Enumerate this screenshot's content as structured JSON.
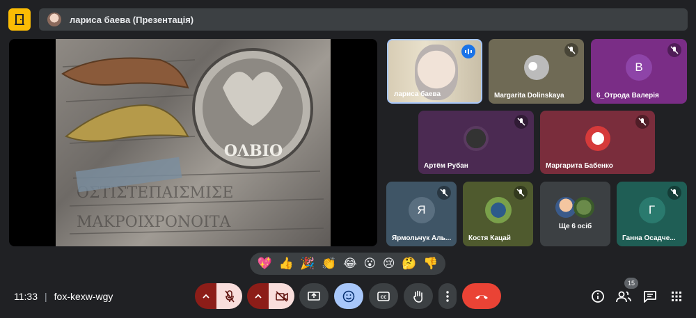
{
  "presentation": {
    "title": "лариса баева (Презентація)",
    "slide_caption": "ΟΛΒΙΟ"
  },
  "participants": [
    {
      "name": "лариса баева",
      "avatar_letter": "",
      "tile_color": "#c9b79a",
      "muted": false,
      "speaking": true
    },
    {
      "name": "Margarita Dolinskaya",
      "avatar_letter": "",
      "tile_color": "#6f6a55",
      "muted": true
    },
    {
      "name": "6_Отрода Валерія",
      "avatar_letter": "В",
      "tile_color": "#7a2d86",
      "muted": true
    },
    {
      "name": "Артём Рубан",
      "avatar_letter": "",
      "tile_color": "#4b2a52",
      "muted": true
    },
    {
      "name": "Маргарита Бабенко",
      "avatar_letter": "",
      "tile_color": "#7a2d3c",
      "muted": true
    },
    {
      "name": "Ярмольчук Аль...",
      "avatar_letter": "Я",
      "tile_color": "#3f5566",
      "muted": true
    },
    {
      "name": "Костя Кацай",
      "avatar_letter": "",
      "tile_color": "#4f5a2e",
      "muted": true
    },
    {
      "name": "Ще 6 осіб",
      "avatar_letter": "",
      "tile_color": "#3c4043",
      "muted": false
    },
    {
      "name": "Ганна Осадче...",
      "avatar_letter": "Г",
      "tile_color": "#1f5e55",
      "muted": true
    }
  ],
  "reactions": [
    "💖",
    "👍",
    "🎉",
    "👏",
    "😂",
    "😮",
    "😢",
    "🤔",
    "👎"
  ],
  "meeting": {
    "time": "11:33",
    "separator": "|",
    "code": "fox-kexw-wgy"
  },
  "controls": {
    "participant_count": "15"
  },
  "colors": {
    "background": "#202124",
    "control_grey": "#3c4043",
    "off_red": "#f9dedc",
    "dark_red": "#8c1d18",
    "end_call": "#ea4335",
    "emoji_active": "#a8c7fa",
    "logo_yellow": "#fbbc04"
  },
  "icons": [
    "door-exit-icon",
    "mic-off-icon",
    "camera-off-icon",
    "chevron-up-icon",
    "present-screen-icon",
    "emoji-icon",
    "captions-icon",
    "raise-hand-icon",
    "more-vert-icon",
    "end-call-icon",
    "info-icon",
    "people-icon",
    "chat-icon",
    "activities-icon"
  ]
}
